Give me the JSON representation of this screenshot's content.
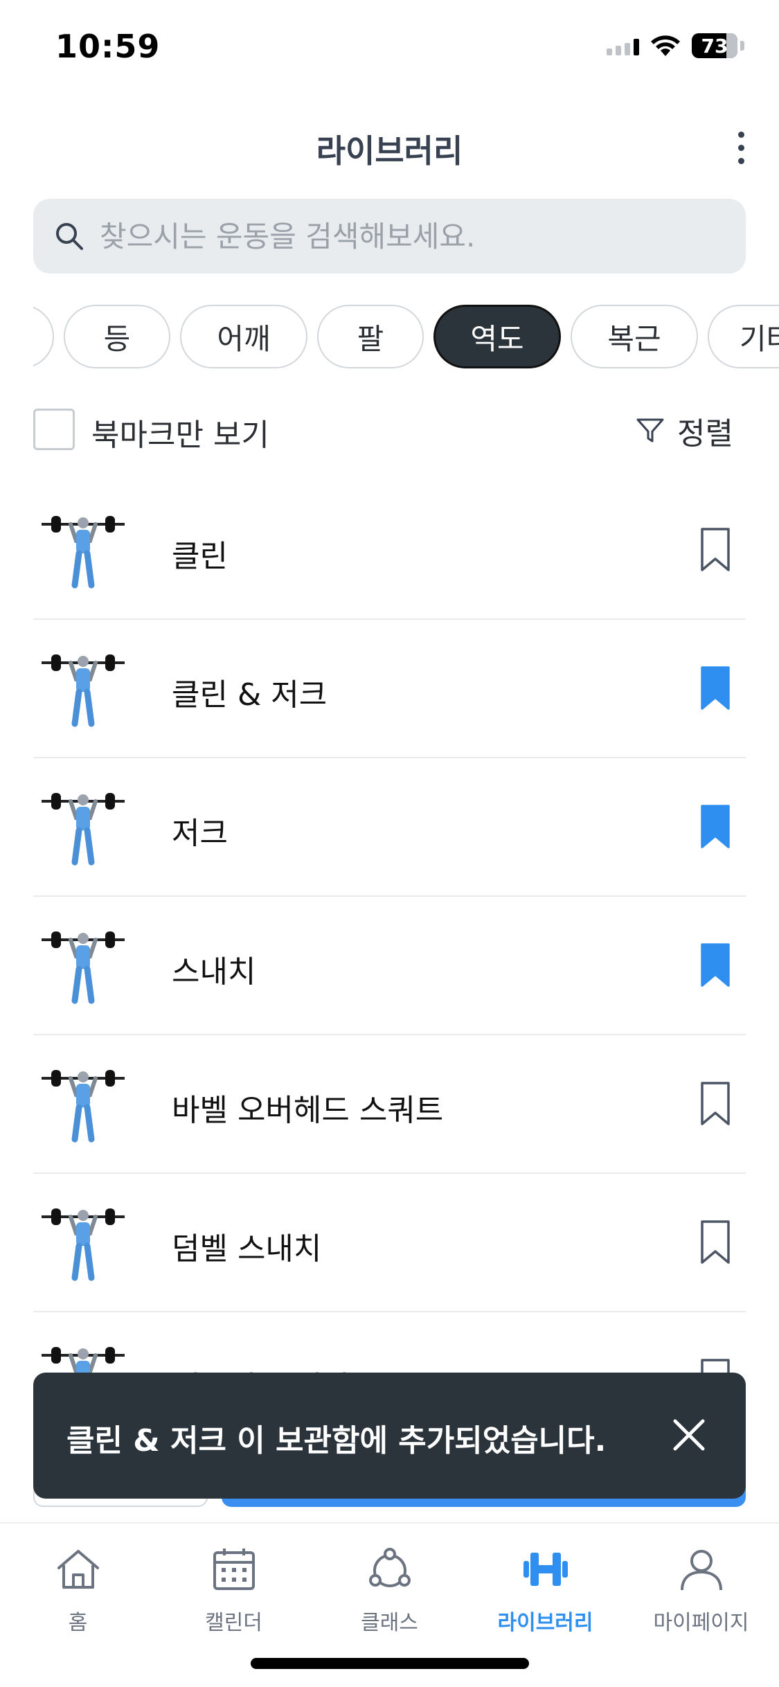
{
  "status_bar": {
    "time": "10:59",
    "battery": "73"
  },
  "header": {
    "title": "라이브러리",
    "more_icon": "more-vertical-icon"
  },
  "search": {
    "placeholder": "찾으시는 운동을 검색해보세요."
  },
  "categories": [
    {
      "label": "",
      "active": false
    },
    {
      "label": "등",
      "active": false
    },
    {
      "label": "어깨",
      "active": false
    },
    {
      "label": "팔",
      "active": false
    },
    {
      "label": "역도",
      "active": true
    },
    {
      "label": "복근",
      "active": false
    },
    {
      "label": "기타",
      "active": false
    }
  ],
  "filter": {
    "bookmark_only_label": "북마크만 보기",
    "bookmark_only_checked": false,
    "sort_label": "정렬"
  },
  "exercises": [
    {
      "name": "클린",
      "bookmarked": false
    },
    {
      "name": "클린 & 저크",
      "bookmarked": true
    },
    {
      "name": "저크",
      "bookmarked": true
    },
    {
      "name": "스내치",
      "bookmarked": true
    },
    {
      "name": "바벨 오버헤드 스쿼트",
      "bookmarked": false
    },
    {
      "name": "덤벨 스내치",
      "bookmarked": false
    },
    {
      "name": "케틀벨 스내치",
      "bookmarked": false
    }
  ],
  "toast": {
    "message": "클린 & 저크 이 보관함에 추가되었습니다."
  },
  "bottom_nav": [
    {
      "label": "홈",
      "icon": "home-icon",
      "active": false
    },
    {
      "label": "캘린더",
      "icon": "calendar-icon",
      "active": false
    },
    {
      "label": "클래스",
      "icon": "class-icon",
      "active": false
    },
    {
      "label": "라이브러리",
      "icon": "dumbbell-icon",
      "active": true
    },
    {
      "label": "마이페이지",
      "icon": "profile-icon",
      "active": false
    }
  ],
  "colors": {
    "accent": "#2f8ff0",
    "dark": "#2b333b",
    "bookmark": "#2f8ff0"
  }
}
